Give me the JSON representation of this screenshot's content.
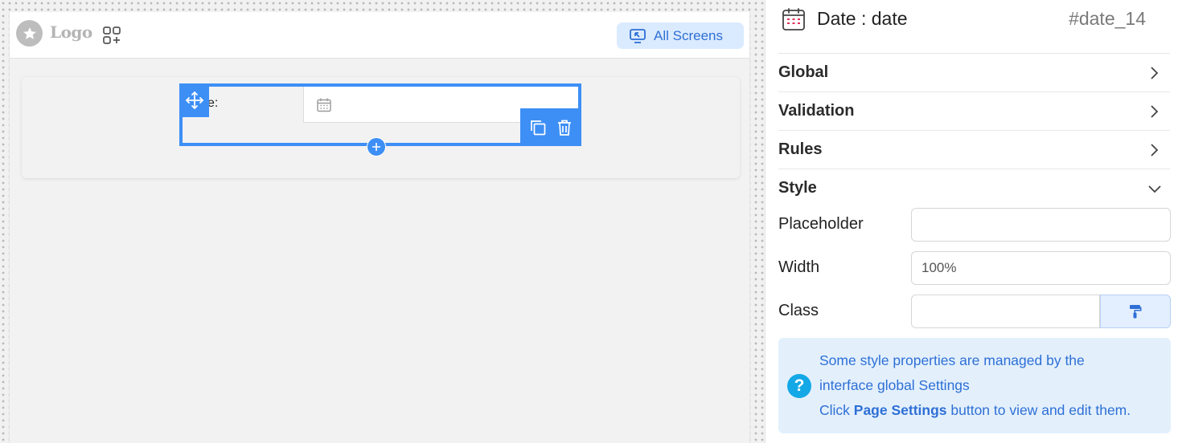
{
  "canvas": {
    "topbar": {
      "logo_text": "Logo",
      "logo_icon": "star-icon",
      "apps_icon": "apps-add-icon",
      "all_screens_label": "All Screens",
      "all_screens_icon": "monitor-arrow-icon"
    },
    "form": {
      "field_label": "e:",
      "field_icon": "calendar-icon",
      "toolbar_icons": [
        "move-icon",
        "copy-icon",
        "trash-icon",
        "plus-icon"
      ]
    }
  },
  "panel": {
    "icon": "date-calendar-icon",
    "title": "Date : date",
    "id": "#date_14",
    "sections": [
      {
        "label": "Global",
        "state": "collapsed"
      },
      {
        "label": "Validation",
        "state": "collapsed"
      },
      {
        "label": "Rules",
        "state": "collapsed"
      },
      {
        "label": "Style",
        "state": "expanded"
      }
    ],
    "style": {
      "placeholder_label": "Placeholder",
      "placeholder_value": "",
      "width_label": "Width",
      "width_value": "100%",
      "class_label": "Class",
      "class_value": "",
      "class_button_icon": "paint-roller-icon"
    },
    "info": {
      "icon": "question-icon",
      "line1": "Some style properties are managed by the",
      "line2": "interface global Settings",
      "line3_pre": "Click ",
      "line3_bold": "Page Settings",
      "line3_post": " button to view and edit them."
    }
  },
  "colors": {
    "accent": "#3d8ff5",
    "link_blue": "#2e6fd6",
    "info_bg": "#e3f0fc",
    "info_icon": "#14a8e6"
  }
}
